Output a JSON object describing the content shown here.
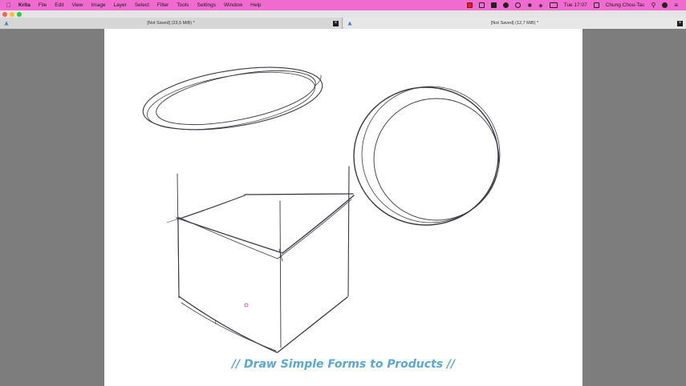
{
  "menubar": {
    "app": "Krita",
    "items": [
      "File",
      "Edit",
      "View",
      "Image",
      "Layer",
      "Select",
      "Filter",
      "Tools",
      "Settings",
      "Window",
      "Help"
    ],
    "clock": "Tue 17:07",
    "user": "Chung Chou-Tac",
    "status_icons": [
      "record-icon",
      "display-icon",
      "chat-icon",
      "shield-icon",
      "time-machine-icon",
      "bluetooth-icon",
      "wifi-icon",
      "battery-icon",
      "flag-icon"
    ]
  },
  "titlebar": {
    "traffic_colors": [
      "#ff5f57",
      "#febc2e",
      "#28c840"
    ]
  },
  "tabs": [
    {
      "label": "[Not Saved]  (23,5 MiB) *",
      "close": "×"
    },
    {
      "label": "[Not Saved]  (12,7 MiB) *",
      "close": "×"
    }
  ],
  "canvas": {
    "caption": "// Draw Simple Forms to Products //",
    "caption_color": "#5aa7cf",
    "stroke_color": "#3a3a44"
  }
}
